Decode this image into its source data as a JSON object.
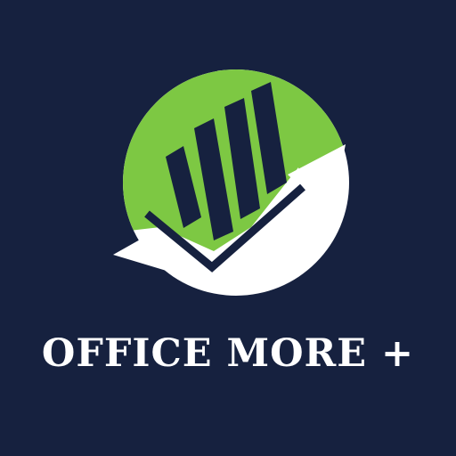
{
  "brand": {
    "name": "OFFICE MORE +"
  },
  "logo": {
    "icon": "growth-chart-arrow-icon",
    "colors": {
      "background": "#16213f",
      "green": "#7dc843",
      "white": "#ffffff",
      "navy": "#16213f"
    }
  }
}
